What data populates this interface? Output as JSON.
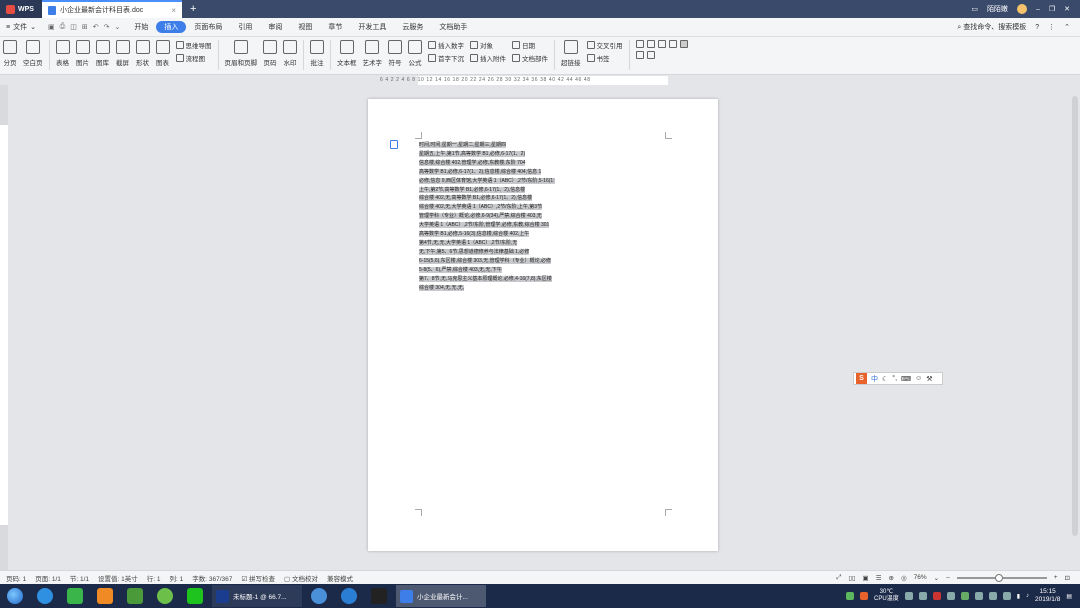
{
  "titlebar": {
    "app_name": "WPS",
    "tab_title": "小企业最新会计科目表.doc",
    "user": "陌陌嫩"
  },
  "menubar": {
    "file_label": "文件",
    "items": [
      "开始",
      "插入",
      "页面布局",
      "引用",
      "审阅",
      "视图",
      "章节",
      "开发工具",
      "云服务",
      "文档助手"
    ],
    "active_index": 1,
    "search_label": "查找命令、搜索模板"
  },
  "ribbon": {
    "groups": [
      {
        "label": "分页"
      },
      {
        "label": "空白页"
      }
    ],
    "insert_objects": [
      {
        "label": "表格"
      },
      {
        "label": "图片"
      },
      {
        "label": "图库"
      },
      {
        "label": "截屏"
      },
      {
        "label": "形状"
      },
      {
        "label": "图表"
      }
    ],
    "small_col1": [
      "思维导图",
      "流程图"
    ],
    "header_footer": [
      {
        "label": "页眉和页脚"
      },
      {
        "label": "页码"
      },
      {
        "label": "水印"
      }
    ],
    "comment": "批注",
    "text_group": [
      {
        "label": "文本框"
      },
      {
        "label": "艺术字"
      },
      {
        "label": "符号"
      },
      {
        "label": "公式"
      }
    ],
    "small_col2": [
      "插入数字",
      "首字下沉"
    ],
    "small_col3": [
      "对象",
      "插入附件"
    ],
    "small_col4": [
      "日期",
      "文档部件"
    ],
    "link_group": [
      {
        "label": "超链接"
      }
    ],
    "small_col5": [
      "交叉引用",
      "书签"
    ]
  },
  "ruler_numbers": "6 4 2 2 4 6 8 10 12 14 16 18 20 22 24 26 28 30 32 34 36 38 40 42 44 46 48",
  "document": {
    "lines": [
      "时间,时间,星期一,星期二,星期三,星期四",
      "星期五,上午,第1节,高等数学 B1,必修,6-17(1、2)",
      "信息楼,综合楼 402,管理学,必修,东教楼,东阶 704",
      "高等数学 B1,必修,6-17(1、2),信息楼,综合楼 404,信息 1",
      "必修,信息 9,西区体育馆,大学英语 1（ABC）,2节/东阶,5-16(1:",
      "上午,第2节,高等数学 B1,必修,6-17(1、2),信息楼",
      "综合楼 402,无,高等数学 B1,必修,6-17(1、2),信息楼",
      "综合楼 402,无,大学英语 1（ABC）,2节/东阶,上午,第3节",
      "管理学科（专业）概论,必修,6-9(34),严禁,综合楼 403,无",
      "大学英语 1（ABC）,2节/东阶,管理学,必修,东教,综合楼 301",
      "高等数学 B1,必修,5-16(3),信息楼,综合楼 402,上午",
      "第4节,无,无,大学英语 1（ABC）,2节/东阶,无",
      "无,下午,第5、6节,思想道德修养与法律基础 1,必修",
      "6-15(5,6),东区楼,综合楼 303,无,管理学科（专业）概论,必修",
      "5-8(5、6),严禁,综合楼 403,无,无,下午",
      "第7、8节,无,马克思主义基本原理概论,必修,4-16(7,8),东区楼",
      "综合楼 304,无,无,无,"
    ]
  },
  "ime": {
    "logo": "S",
    "label": "中"
  },
  "statusbar": {
    "page_num": "页码: 1",
    "pages": "页面: 1/1",
    "section": "节: 1/1",
    "setting": "设置值: 1英寸",
    "row": "行: 1",
    "col": "列: 1",
    "word_count": "字数: 367/367",
    "spell_check": "拼写检查",
    "doc_check": "文档校对",
    "compat_mode": "兼容模式",
    "zoom": "76%"
  },
  "taskbar": {
    "task1": "未标题-1 @ 66.7...",
    "task2": "小企业最新会计...",
    "weather_temp": "30℃",
    "weather_label": "CPU温度",
    "time": "15:15",
    "date": "2019/1/8"
  },
  "colors": {
    "accent": "#3e7ee8",
    "titlebar": "#3a4a6b",
    "taskbar": "#1c2a4a"
  }
}
